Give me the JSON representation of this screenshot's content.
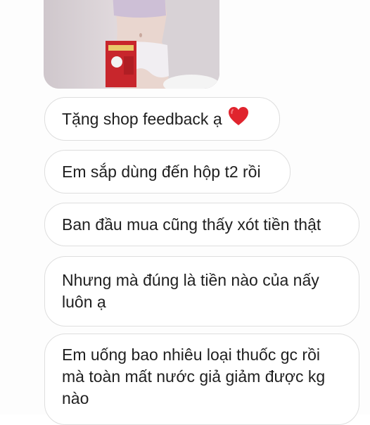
{
  "messages": [
    {
      "text": "Tặng shop feedback ạ",
      "emoji": "red-heart"
    },
    {
      "text": "Em sắp dùng đến hộp t2 rồi"
    },
    {
      "text": "Ban đầu mua cũng thấy xót tiền thật"
    },
    {
      "text": "Nhưng mà đúng là tiền nào của nấy\nluôn ạ"
    },
    {
      "text": "Em uống bao nhiêu loại thuốc gc rồi\nmà toàn mất nước giả giảm được kg\nnào"
    }
  ],
  "photo": {
    "description_icon": "product-feedback-photo"
  },
  "colors": {
    "bubble_border": "#dedede",
    "bubble_bg": "#ffffff",
    "text": "#1f1f1f",
    "heart": "#e0242e"
  }
}
